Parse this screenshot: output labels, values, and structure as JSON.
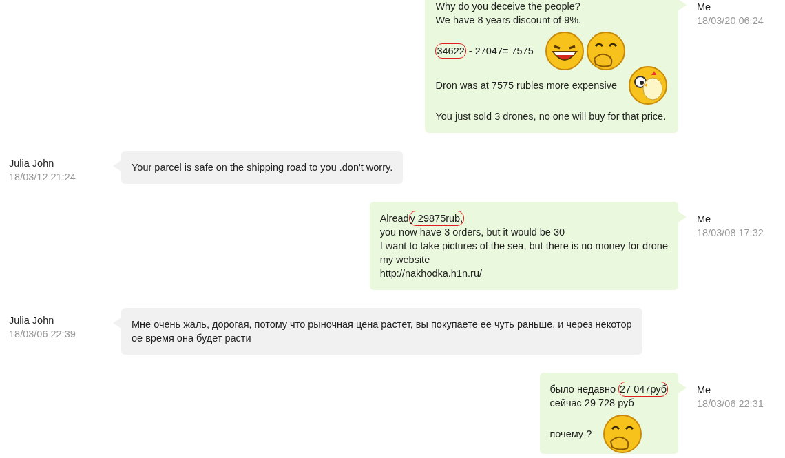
{
  "messages": [
    {
      "kind": "sent",
      "sender": "Me",
      "time": "18/03/20 06:24",
      "paragraphs": [
        {
          "kind": "plain",
          "lines": [
            [
              {
                "text": "Why do you deceive the people?",
                "circled": false
              }
            ],
            [
              {
                "text": "We have 8 years discount of 9%.",
                "circled": false
              }
            ]
          ]
        },
        {
          "kind": "stickers",
          "lines": [
            [
              {
                "text": "34622",
                "circled": true
              },
              {
                "text": " - 27047= 7575",
                "circled": false
              }
            ]
          ]
        },
        {
          "kind": "stickers",
          "lines": [
            [
              {
                "text": "Dron was at 7575 rubles more expensive",
                "circled": false
              }
            ]
          ]
        },
        {
          "kind": "plain",
          "lines": [
            [
              {
                "text": "You just sold 3 drones, no one will buy for that price.",
                "circled": false
              }
            ]
          ]
        }
      ]
    },
    {
      "kind": "received",
      "sender": "Julia John",
      "time": "18/03/12 21:24",
      "paragraphs": [
        {
          "kind": "plain",
          "lines": [
            [
              {
                "text": "Your parcel is safe on the shipping road to you .don't worry.",
                "circled": false
              }
            ]
          ]
        }
      ]
    },
    {
      "kind": "sent",
      "sender": "Me",
      "time": "18/03/08 17:32",
      "paragraphs": [
        {
          "kind": "plain",
          "lines": [
            [
              {
                "text": "Alread",
                "circled": false
              },
              {
                "text": "y 29875rub,",
                "circled": true
              }
            ],
            [
              {
                "text": "you now have 3 orders, but it would be 30",
                "circled": false
              }
            ],
            [
              {
                "text": "I want to take pictures of the sea, but there is no money for drone",
                "circled": false
              }
            ],
            [
              {
                "text": "my website",
                "circled": false
              }
            ],
            [
              {
                "text": "http://nakhodka.h1n.ru/",
                "circled": false
              }
            ]
          ]
        }
      ]
    },
    {
      "kind": "received",
      "sender": "Julia John",
      "time": "18/03/06 22:39",
      "paragraphs": [
        {
          "kind": "plain",
          "lines": [
            [
              {
                "text": "Мне очень жаль, дорогая, потому что рыночная цена растет, вы покупаете ее чуть раньше, и через некотор",
                "circled": false
              }
            ],
            [
              {
                "text": "ое время она будет расти",
                "circled": false
              }
            ]
          ]
        }
      ]
    },
    {
      "kind": "sent",
      "sender": "Me",
      "time": "18/03/06 22:31",
      "paragraphs": [
        {
          "kind": "plain",
          "lines": [
            [
              {
                "text": "было недавно ",
                "circled": false
              },
              {
                "text": "27 047руб",
                "circled": true
              }
            ],
            [
              {
                "text": "сейчас 29 728 руб",
                "circled": false
              }
            ]
          ]
        },
        {
          "kind": "stickers",
          "lines": [
            [
              {
                "text": "почему ?",
                "circled": false
              }
            ]
          ]
        }
      ]
    }
  ]
}
